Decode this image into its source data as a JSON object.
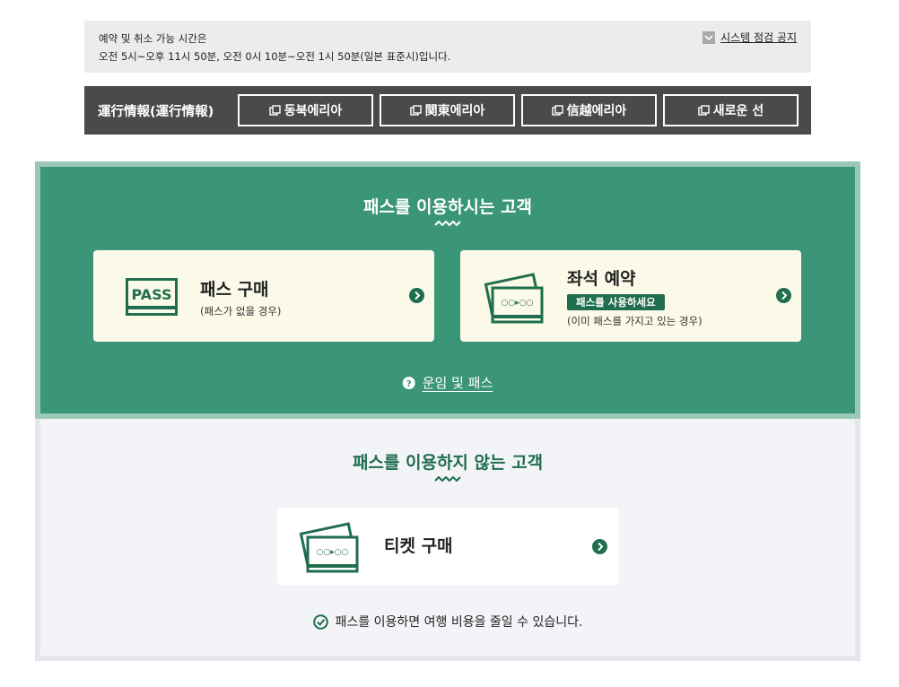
{
  "notice": {
    "line1": "예약 및 취소 가능 시간은",
    "line2": "오전 5시~오후 11시 50분, 오전 0시 10분~오전 1시 50분(일본 표준시)입니다.",
    "link_label": "시스템 점검 공지"
  },
  "operation": {
    "title": "運行情報(運行情報)",
    "areas": [
      {
        "label": "동북에리아"
      },
      {
        "label": "関東에리아"
      },
      {
        "label": "信越에리아"
      },
      {
        "label": "새로운 선"
      }
    ]
  },
  "pass_users": {
    "heading": "패스를 이용하시는 고객",
    "buy_pass": {
      "icon_text": "PASS",
      "title": "패스 구매",
      "subtitle": "(패스가 없을 경우)"
    },
    "seat_reservation": {
      "title": "좌석 예약",
      "badge": "패스를 사용하세요",
      "subtitle": "(이미 패스를 가지고 있는 경우)"
    },
    "fare_link": "운임 및 패스"
  },
  "non_pass_users": {
    "heading": "패스를 이용하지 않는 고객",
    "buy_ticket": {
      "title": "티켓 구매"
    },
    "benefit": "패스를 이용하면 여행 비용을 줄일 수 있습니다."
  },
  "colors": {
    "brand_green": "#3a9676",
    "dark_green": "#1f6e4e",
    "card_cream": "#fbf9e8",
    "op_bar": "#4a4a4a"
  }
}
